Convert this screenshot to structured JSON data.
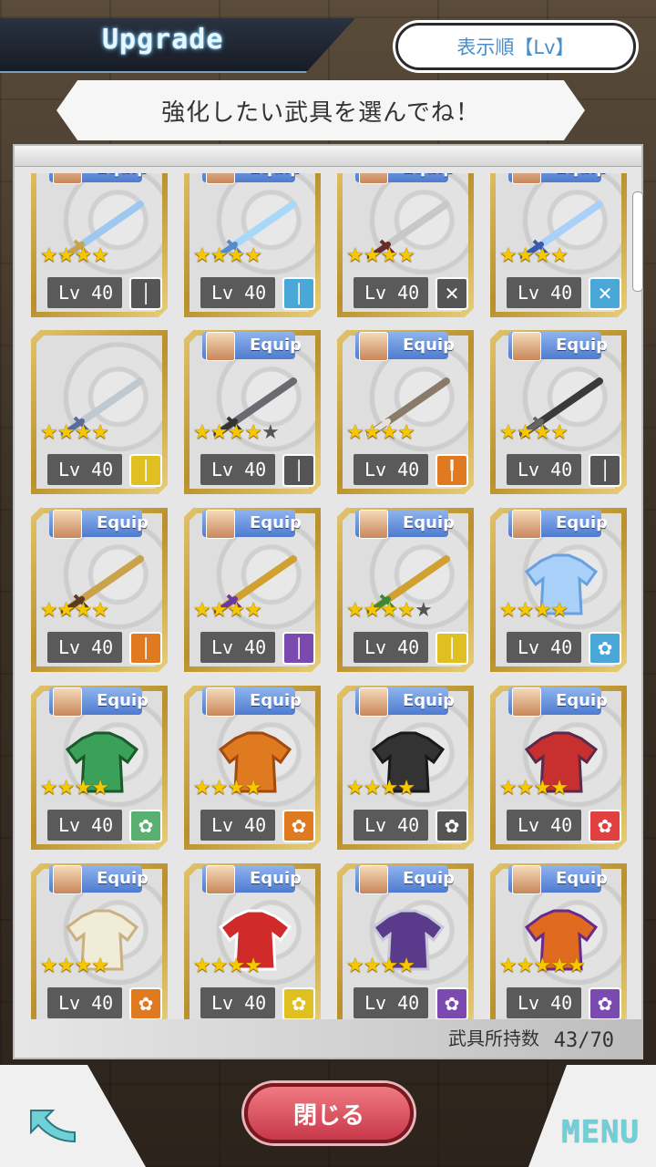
{
  "header": {
    "title": "Upgrade",
    "sort_button": "表示順【Lv】"
  },
  "banner": {
    "text": "強化したい武具を選んでね！"
  },
  "footer": {
    "count_label": "武具所持数",
    "count_value": "43/70"
  },
  "bottom": {
    "close_label": "閉じる",
    "menu_label": "MENU"
  },
  "equip_label": "Equip",
  "items": [
    {
      "level": "Lv 40",
      "stars": 4,
      "max_stars": 4,
      "equipped": true,
      "type": "sword",
      "type_icon": "│",
      "type_color": "#555555",
      "art": "blue-curved-sword"
    },
    {
      "level": "Lv 40",
      "stars": 4,
      "max_stars": 4,
      "equipped": true,
      "type": "sword",
      "type_icon": "│",
      "type_color": "#4aa8d8",
      "art": "ice-sword"
    },
    {
      "level": "Lv 40",
      "stars": 4,
      "max_stars": 4,
      "equipped": true,
      "type": "dual",
      "type_icon": "✕",
      "type_color": "#555555",
      "art": "twin-swords"
    },
    {
      "level": "Lv 40",
      "stars": 4,
      "max_stars": 4,
      "equipped": true,
      "type": "dual",
      "type_icon": "✕",
      "type_color": "#4aa8d8",
      "art": "ice-twin-swords"
    },
    {
      "level": "Lv 40",
      "stars": 4,
      "max_stars": 4,
      "equipped": false,
      "type": "rapier",
      "type_icon": "│",
      "type_color": "#e0c020",
      "art": "silver-longsword"
    },
    {
      "level": "Lv 40",
      "stars": 4,
      "max_stars": 5,
      "equipped": true,
      "type": "sword",
      "type_icon": "│",
      "type_color": "#555555",
      "art": "serrated-sword"
    },
    {
      "level": "Lv 40",
      "stars": 4,
      "max_stars": 4,
      "equipped": true,
      "type": "mace",
      "type_icon": "╿",
      "type_color": "#e07a20",
      "art": "spiked-mace"
    },
    {
      "level": "Lv 40",
      "stars": 4,
      "max_stars": 4,
      "equipped": true,
      "type": "gun",
      "type_icon": "│",
      "type_color": "#555555",
      "art": "sniper-rifle"
    },
    {
      "level": "Lv 40",
      "stars": 4,
      "max_stars": 4,
      "equipped": true,
      "type": "staff",
      "type_icon": "│",
      "type_color": "#e07a20",
      "art": "gold-staff"
    },
    {
      "level": "Lv 40",
      "stars": 4,
      "max_stars": 4,
      "equipped": true,
      "type": "staff",
      "type_icon": "│",
      "type_color": "#7a4ab0",
      "art": "purple-staff"
    },
    {
      "level": "Lv 40",
      "stars": 4,
      "max_stars": 5,
      "equipped": true,
      "type": "staff",
      "type_icon": "│",
      "type_color": "#e0c020",
      "art": "holly-staff"
    },
    {
      "level": "Lv 40",
      "stars": 4,
      "max_stars": 4,
      "equipped": true,
      "type": "armor",
      "type_icon": "✿",
      "type_color": "#4aa8d8",
      "art": "blue-dress"
    },
    {
      "level": "Lv 40",
      "stars": 4,
      "max_stars": 4,
      "equipped": true,
      "type": "armor",
      "type_icon": "✿",
      "type_color": "#5ab070",
      "art": "green-armor"
    },
    {
      "level": "Lv 40",
      "stars": 4,
      "max_stars": 4,
      "equipped": true,
      "type": "armor",
      "type_icon": "✿",
      "type_color": "#e07a20",
      "art": "orange-tunic"
    },
    {
      "level": "Lv 40",
      "stars": 4,
      "max_stars": 4,
      "equipped": true,
      "type": "armor",
      "type_icon": "✿",
      "type_color": "#555555",
      "art": "black-coat"
    },
    {
      "level": "Lv 40",
      "stars": 4,
      "max_stars": 4,
      "equipped": true,
      "type": "armor",
      "type_icon": "✿",
      "type_color": "#e04040",
      "art": "red-robe"
    },
    {
      "level": "Lv 40",
      "stars": 4,
      "max_stars": 4,
      "equipped": true,
      "type": "armor",
      "type_icon": "✿",
      "type_color": "#e07a20",
      "art": "white-robe"
    },
    {
      "level": "Lv 40",
      "stars": 4,
      "max_stars": 4,
      "equipped": true,
      "type": "armor",
      "type_icon": "✿",
      "type_color": "#e0c020",
      "art": "santa-dress"
    },
    {
      "level": "Lv 40",
      "stars": 4,
      "max_stars": 4,
      "equipped": true,
      "type": "armor",
      "type_icon": "✿",
      "type_color": "#7a4ab0",
      "art": "purple-coat"
    },
    {
      "level": "Lv 40",
      "stars": 5,
      "max_stars": 5,
      "equipped": true,
      "type": "armor",
      "type_icon": "✿",
      "type_color": "#7a4ab0",
      "art": "halloween-dress"
    }
  ],
  "colors": {
    "frame_gold": "#c9a23c",
    "equip_blue": "#5a86d8",
    "star_yellow": "#f5c800",
    "close_red": "#d44a58",
    "menu_teal": "#6fd0d8"
  }
}
